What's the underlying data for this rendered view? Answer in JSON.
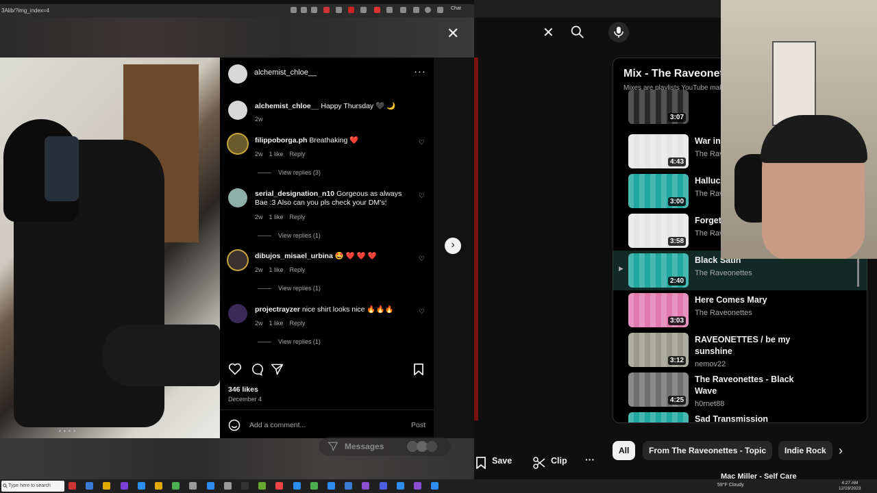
{
  "browser": {
    "url_fragment": "3Alib/?img_index=4",
    "ext_label": "Chat"
  },
  "instagram": {
    "post_username": "alchemist_chloe__",
    "more_glyph": "···",
    "comments": [
      {
        "user": "alchemist_chloe__",
        "text": "Happy Thursday 🖤 🌙",
        "time": "2w",
        "likes": "",
        "reply": "",
        "view_replies": ""
      },
      {
        "user": "filippoborga.ph",
        "text": "Breathaking ❤️",
        "time": "2w",
        "likes": "1 like",
        "reply": "Reply",
        "view_replies": "View replies (3)"
      },
      {
        "user": "serial_designation_n10",
        "text": "Gorgeous as always Bae :3 Also can you pls check your DM's🕯",
        "time": "2w",
        "likes": "1 like",
        "reply": "Reply",
        "view_replies": "View replies (1)"
      },
      {
        "user": "dibujos_misael_urbina",
        "text": "🤩 ❤️ ❤️ ❤️",
        "time": "2w",
        "likes": "1 like",
        "reply": "Reply",
        "view_replies": "View replies (1)"
      },
      {
        "user": "projectrayzer",
        "text": "nice shirt looks nice 🔥🔥🔥",
        "time": "2w",
        "likes": "1 like",
        "reply": "Reply",
        "view_replies": "View replies (1)"
      }
    ],
    "likes_count": "346 likes",
    "post_date": "December 4",
    "comment_placeholder": "Add a comment...",
    "post_button": "Post",
    "messages_label": "Messages",
    "close_glyph": "✕",
    "next_glyph": "›",
    "carousel_dots": "• • • •"
  },
  "youtube": {
    "search_close_glyph": "✕",
    "mix_title": "Mix - The Raveonettes",
    "mix_subtitle": "Mixes are playlists YouTube makes for you",
    "playlist": [
      {
        "title": "",
        "channel": "",
        "duration": "3:07",
        "active": false,
        "thumb_color": "#2a2a2a"
      },
      {
        "title": "War in",
        "channel": "The Raveonettes",
        "duration": "4:43",
        "active": false,
        "thumb_color": "#e6e6e6"
      },
      {
        "title": "Halluci",
        "channel": "The Raveonettes",
        "duration": "3:00",
        "active": false,
        "thumb_color": "#1fa7a0"
      },
      {
        "title": "Forget",
        "channel": "The Raveonettes",
        "duration": "3:58",
        "active": false,
        "thumb_color": "#e6e6e6"
      },
      {
        "title": "Black Satin",
        "channel": "The Raveonettes",
        "duration": "2:40",
        "active": true,
        "thumb_color": "#1fa7a0"
      },
      {
        "title": "Here Comes Mary",
        "channel": "The Raveonettes",
        "duration": "3:03",
        "active": false,
        "thumb_color": "#e079b0"
      },
      {
        "title": "RAVEONETTES / be my sunshine",
        "channel": "nemov22",
        "duration": "3:12",
        "active": false,
        "thumb_color": "#9a9a8a"
      },
      {
        "title": "The Raveonettes - Black Wave",
        "channel": "h0rnet88",
        "duration": "4:25",
        "active": false,
        "thumb_color": "#6e6e6e"
      },
      {
        "title": "Sad Transmission",
        "channel": "",
        "duration": "",
        "active": false,
        "thumb_color": "#1fa7a0"
      }
    ],
    "chips": [
      "All",
      "From The Raveonettes - Topic",
      "Indie Rock"
    ],
    "actions": {
      "save": "Save",
      "clip": "Clip",
      "more": "···"
    },
    "next_up": "Mac Miller - Self Care"
  },
  "taskbar": {
    "search_placeholder": "Type here to search",
    "weather": "59°F Cloudy",
    "time": "4:27 AM",
    "date": "12/19/2023"
  },
  "colors": {
    "instagram_bg": "#000000",
    "youtube_bg": "#0f0f0f",
    "active_row": "#122a26",
    "like_red": "#ed4956"
  }
}
